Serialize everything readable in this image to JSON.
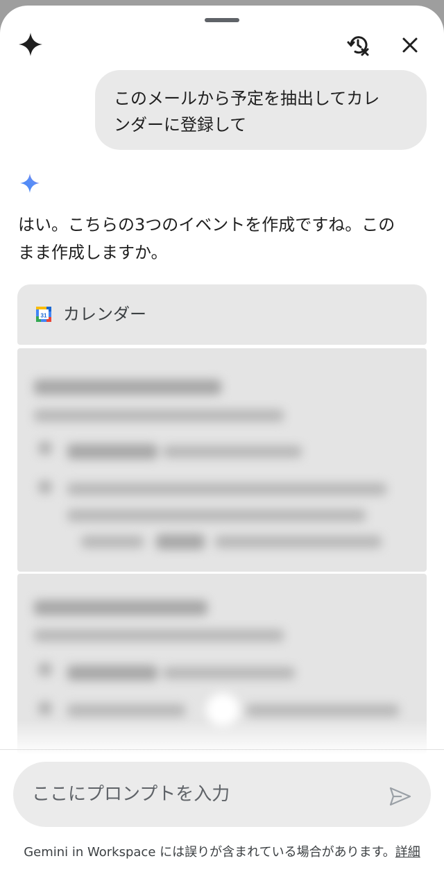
{
  "user_message": {
    "line1": "このメールから予定を抽出してカレ",
    "line2": "ンダーに登録して"
  },
  "assistant": {
    "line1": "はい。こちらの3つのイベントを作成ですね。この",
    "line2": "まま作成しますか。"
  },
  "calendar": {
    "label": "カレンダー",
    "icon_day": "31"
  },
  "input": {
    "placeholder": "ここにプロンプトを入力"
  },
  "footer": {
    "disclaimer": "Gemini in Workspace には誤りが含まれている場合があります。",
    "link": "詳細"
  },
  "icons": {
    "top_left": "gemini-star-icon",
    "history": "history-off-icon",
    "close": "close-icon",
    "assistant": "gemini-sparkle-icon",
    "calendar": "google-calendar-icon",
    "send": "send-icon"
  },
  "colors": {
    "sheet": "#ffffff",
    "bubble": "#e9e9e9",
    "card": "#e4e4e4",
    "text": "#1f1f1f",
    "backdrop": "#9e9e9e"
  }
}
